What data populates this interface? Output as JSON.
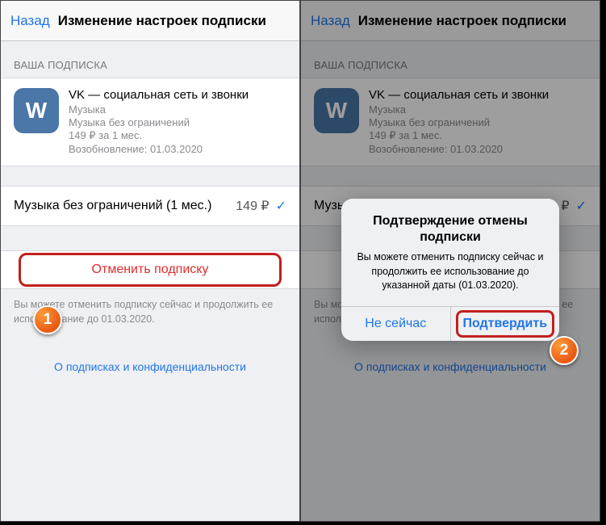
{
  "nav": {
    "back": "Назад",
    "title": "Изменение настроек подписки"
  },
  "section_header": "ВАША ПОДПИСКА",
  "app": {
    "icon_text": "W",
    "name": "VK — социальная сеть и звонки",
    "sub1": "Музыка",
    "sub2": "Музыка без ограничений",
    "price": "149 ₽ за 1 мес.",
    "renewal": "Возобновление: 01.03.2020"
  },
  "option": {
    "label": "Музыка без ограничений (1 мес.)",
    "price": "149 ₽",
    "check": "✓"
  },
  "cancel_label": "Отменить подписку",
  "footer_note": "Вы можете отменить подписку сейчас и продолжить ее использование до 01.03.2020.",
  "privacy_link": "О подписках и конфиденциальности",
  "alert": {
    "title": "Подтверждение отмены подписки",
    "message": "Вы можете отменить подписку сейчас и продолжить ее использование до указанной даты (01.03.2020).",
    "not_now": "Не сейчас",
    "confirm": "Подтвердить"
  },
  "badges": {
    "one": "1",
    "two": "2"
  }
}
